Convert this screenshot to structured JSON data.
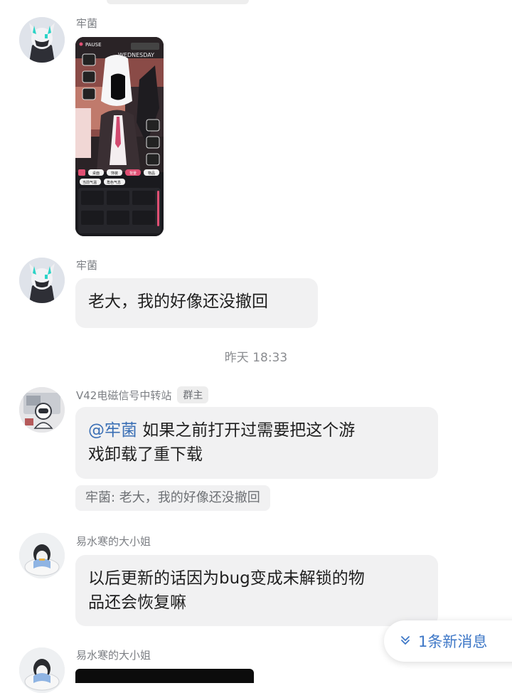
{
  "messages": [
    {
      "sender": "牢菌",
      "type": "image"
    },
    {
      "sender": "牢菌",
      "text": "老大，我的好像还没撤回"
    },
    {
      "timestamp": "昨天 18:33"
    },
    {
      "sender": "V42电磁信号中转站",
      "badge": "群主",
      "mention": "@牢菌",
      "text_line1": " 如果之前打开过需要把这个游",
      "text_line2": "戏卸载了重下载",
      "quote": "牢菌: 老大，我的好像还没撤回"
    },
    {
      "sender": "易水寒的大小姐",
      "text_line1": "以后更新的话因为bug变成未解锁的物",
      "text_line2": "品还会恢复嘛"
    },
    {
      "sender": "易水寒的大小姐",
      "type": "image"
    }
  ],
  "screenshot": {
    "pause_label": "PAUSE",
    "day": "WEDNESDAY",
    "tabs": [
      "桌面",
      "饰装",
      "背景",
      "物品"
    ],
    "chips": [
      "当前气温",
      "角色气息"
    ]
  },
  "new_messages": {
    "icon": "chevron-double-down-icon",
    "label": "1条新消息"
  }
}
